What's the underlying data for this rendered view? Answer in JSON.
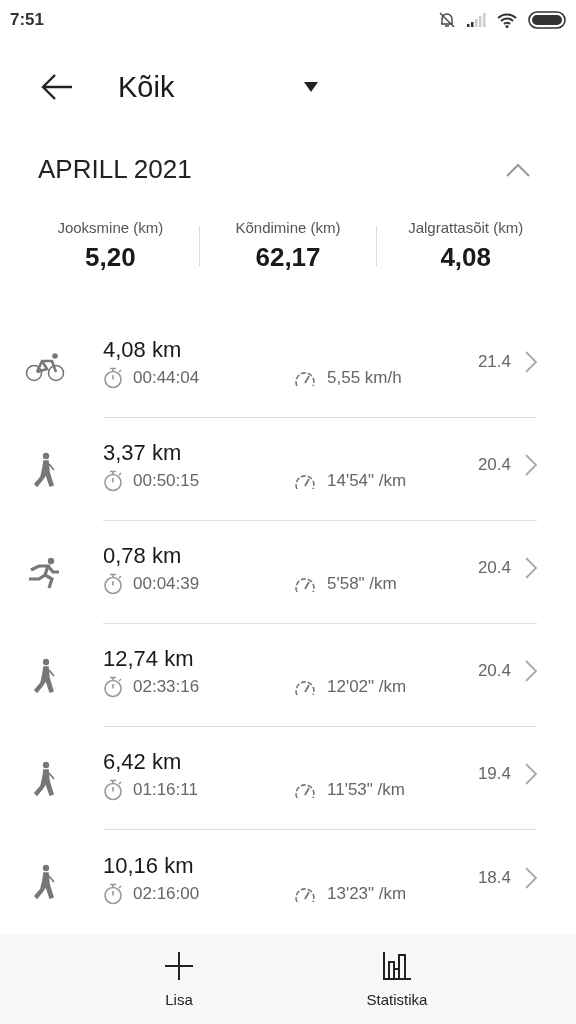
{
  "status_bar": {
    "time": "7:51"
  },
  "header": {
    "title": "Kõik"
  },
  "month": {
    "title": "APRILL 2021",
    "expanded": true
  },
  "summary": [
    {
      "label": "Jooksmine (km)",
      "value": "5,20"
    },
    {
      "label": "Kõndimine (km)",
      "value": "62,17"
    },
    {
      "label": "Jalgrattasõit (km)",
      "value": "4,08"
    }
  ],
  "activities": [
    {
      "kind": "bike",
      "distance": "4,08 km",
      "duration": "00:44:04",
      "pace": "5,55 km/h",
      "date": "21.4"
    },
    {
      "kind": "walk",
      "distance": "3,37 km",
      "duration": "00:50:15",
      "pace": "14'54\" /km",
      "date": "20.4"
    },
    {
      "kind": "run",
      "distance": "0,78 km",
      "duration": "00:04:39",
      "pace": "5'58\" /km",
      "date": "20.4"
    },
    {
      "kind": "walk",
      "distance": "12,74 km",
      "duration": "02:33:16",
      "pace": "12'02\" /km",
      "date": "20.4"
    },
    {
      "kind": "walk",
      "distance": "6,42 km",
      "duration": "01:16:11",
      "pace": "11'53\" /km",
      "date": "19.4"
    },
    {
      "kind": "walk",
      "distance": "10,16 km",
      "duration": "02:16:00",
      "pace": "13'23\" /km",
      "date": "18.4"
    }
  ],
  "bottom_nav": [
    {
      "kind": "add",
      "label": "Lisa"
    },
    {
      "kind": "stats",
      "label": "Statistika"
    }
  ]
}
